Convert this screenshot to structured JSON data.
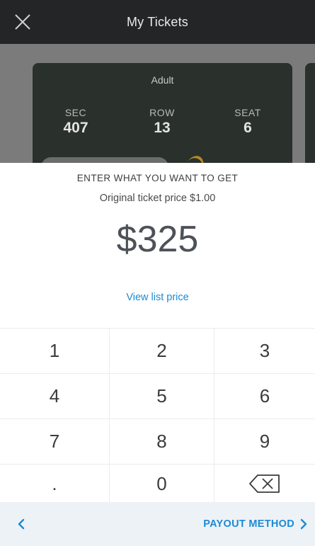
{
  "header": {
    "title": "My Tickets",
    "close_icon": "close-icon"
  },
  "ticket": {
    "type": "Adult",
    "sec_label": "SEC",
    "sec_value": "407",
    "row_label": "ROW",
    "row_value": "13",
    "seat_label": "SEAT",
    "seat_value": "6"
  },
  "entry": {
    "heading": "ENTER WHAT YOU WANT TO GET",
    "subheading": "Original ticket price $1.00",
    "price": "$325",
    "view_link": "View list price"
  },
  "keypad": {
    "k1": "1",
    "k2": "2",
    "k3": "3",
    "k4": "4",
    "k5": "5",
    "k6": "6",
    "k7": "7",
    "k8": "8",
    "k9": "9",
    "kdot": ".",
    "k0": "0",
    "backspace_icon": "backspace-icon"
  },
  "footer": {
    "back_icon": "chevron-left-icon",
    "next_label": "PAYOUT METHOD",
    "next_icon": "chevron-right-icon"
  },
  "colors": {
    "header_bg": "#242526",
    "ticket_card_bg": "#2a312d",
    "accent_blue": "#1c8ad6",
    "footer_bg": "#edf2f7"
  }
}
